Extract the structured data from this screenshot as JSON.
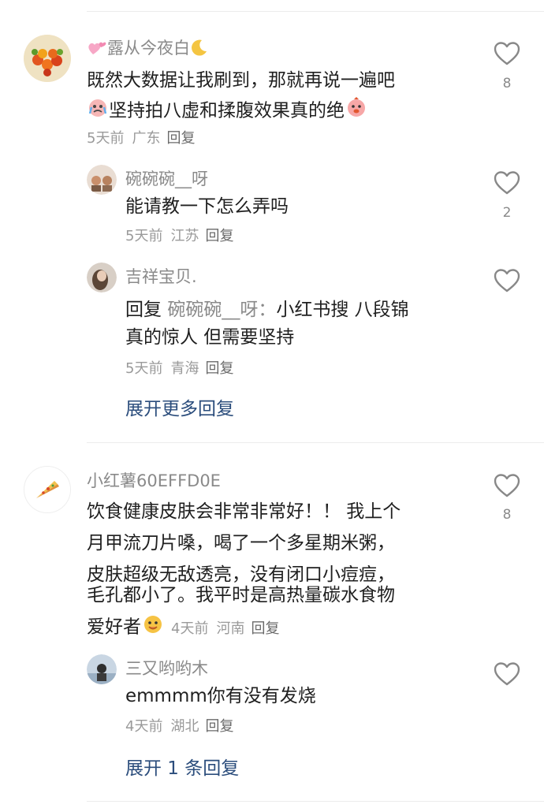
{
  "comments": [
    {
      "user": "露从今夜白",
      "lines": [
        "既然大数据让我刷到，那就再说一遍吧",
        "坚持拍八虚和揉腹效果真的绝"
      ],
      "time": "5天前",
      "location": "广东",
      "reply_label": "回复",
      "likes": "8",
      "replies": [
        {
          "user": "碗碗碗__呀",
          "text": "能请教一下怎么弄吗",
          "time": "5天前",
          "location": "江苏",
          "reply_label": "回复",
          "likes": "2"
        },
        {
          "user": "吉祥宝贝.",
          "reply_prefix": "回复",
          "reply_target": "碗碗碗__呀：",
          "line1": "小红书搜 八段锦",
          "line2": "真的惊人 但需要坚持",
          "time": "5天前",
          "location": "青海",
          "reply_label": "回复",
          "likes": ""
        }
      ],
      "expand": "展开更多回复"
    },
    {
      "user": "小红薯60EFFD0E",
      "lines": [
        "饮食健康皮肤会非常非常好！！ 我上个",
        "月甲流刀片嗓，喝了一个多星期米粥，",
        "皮肤超级无敌透亮，没有闭口小痘痘，",
        "毛孔都小了。我平时是高热量碳水食物",
        "爱好者"
      ],
      "time": "4天前",
      "location": "河南",
      "reply_label": "回复",
      "likes": "8",
      "replies": [
        {
          "user": "三又哟哟木",
          "text": "emmmm你有没有发烧",
          "time": "4天前",
          "location": "湖北",
          "reply_label": "回复",
          "likes": ""
        }
      ],
      "expand": "展开 1 条回复"
    }
  ],
  "icons": {
    "like": "heart-outline-icon"
  }
}
